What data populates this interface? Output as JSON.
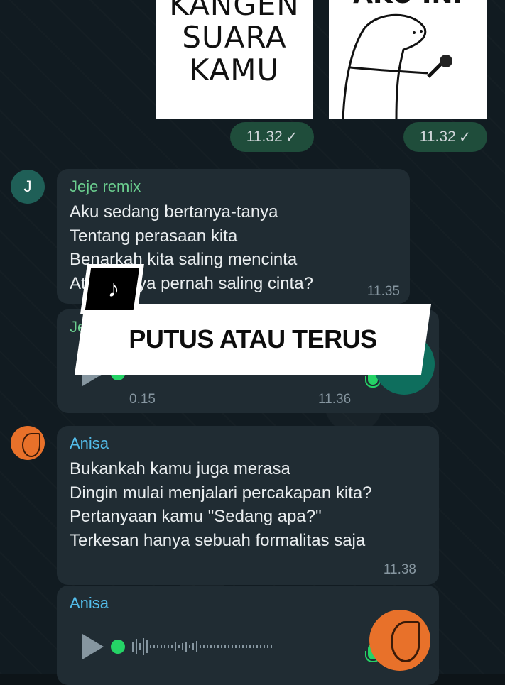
{
  "sticker_left": {
    "lines": [
      "KANGEN",
      "SUARA",
      "KAMU"
    ]
  },
  "sticker_right": {
    "caption": "AKU INI"
  },
  "sticker_times": [
    "11.32",
    "11.32"
  ],
  "messages": [
    {
      "avatar_letter": "J",
      "sender": "Jeje remix",
      "lines": [
        "Aku sedang bertanya-tanya",
        "Tentang perasaan kita",
        "Benarkah kita saling mencinta",
        "Atau hanya pernah saling cinta?"
      ],
      "time": "11.35"
    },
    {
      "sender": "Jeje remix",
      "voice_duration": "0.15",
      "time": "11.36"
    },
    {
      "sender": "Anisa",
      "lines": [
        "Bukankah kamu juga merasa",
        "Dingin mulai menjalari percakapan kita?",
        "Pertanyaan kamu \"Sedang apa?\"",
        "Terkesan hanya sebuah formalitas saja"
      ],
      "time": "11.38"
    },
    {
      "sender": "Anisa"
    }
  ],
  "overlay": {
    "title": "PUTUS ATAU TERUS"
  },
  "icons": {
    "check": "check-icon",
    "play": "play-icon",
    "mic": "mic-icon",
    "tiktok": "tiktok-logo-icon"
  },
  "colors": {
    "background": "#111b21",
    "bubble": "#202c33",
    "sender_jeje": "#6bcf8f",
    "sender_anisa": "#53bdeb",
    "voice_dot": "#25d366"
  }
}
